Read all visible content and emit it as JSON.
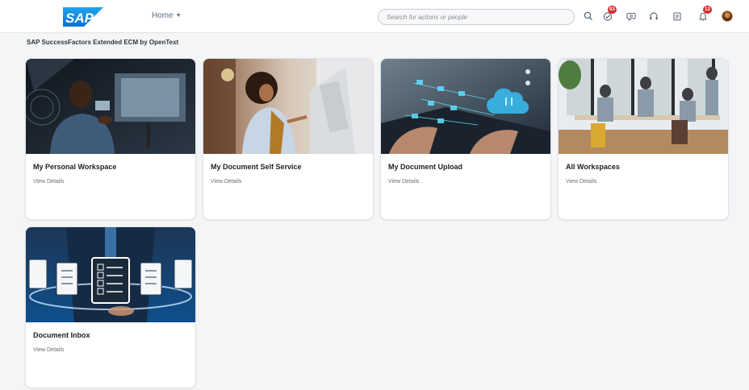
{
  "shell": {
    "logo_text": "SAP",
    "home_label": "Home",
    "search": {
      "placeholder": "Search for actions or people"
    },
    "icons": [
      {
        "name": "search-icon"
      },
      {
        "name": "task-check-icon",
        "badge": "83"
      },
      {
        "name": "chat-icon"
      },
      {
        "name": "headset-icon"
      },
      {
        "name": "notes-icon"
      },
      {
        "name": "bell-icon",
        "badge": "12"
      },
      {
        "name": "avatar"
      }
    ]
  },
  "page": {
    "title": "SAP SuccessFactors Extended ECM by OpenText"
  },
  "tiles": [
    {
      "title": "My Personal Workspace",
      "subtitle": "View Details",
      "image": "man-touchscreen-image"
    },
    {
      "title": "My Document Self Service",
      "subtitle": "View Details",
      "image": "woman-kiosk-image"
    },
    {
      "title": "My Document Upload",
      "subtitle": "View Details",
      "image": "cloud-upload-laptop-image"
    },
    {
      "title": "All Workspaces",
      "subtitle": "View Details",
      "image": "office-team-image"
    },
    {
      "title": "Document Inbox",
      "subtitle": "View Details",
      "image": "clipboard-checklist-image"
    }
  ],
  "colors": {
    "sap_blue": "#0a6ed1",
    "badge_red": "#d52e2e",
    "background": "#f4f5f7"
  }
}
